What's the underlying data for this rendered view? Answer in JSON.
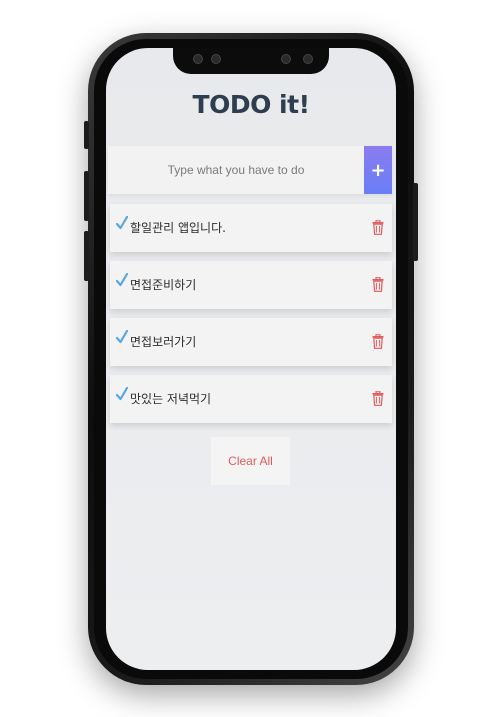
{
  "app": {
    "title": "TODO it!"
  },
  "input": {
    "placeholder": "Type what you have to do",
    "value": ""
  },
  "add_button": {
    "label": "+"
  },
  "todos": [
    {
      "text": "할일관리 앱입니다.",
      "completed": false
    },
    {
      "text": "면접준비하기",
      "completed": false
    },
    {
      "text": "면접보러가기",
      "completed": false
    },
    {
      "text": "맛있는 저녁먹기",
      "completed": false
    }
  ],
  "clear_button": {
    "label": "Clear All"
  },
  "colors": {
    "accent": "#7b7ef2",
    "title": "#2c3e50",
    "check": "#5aa6e0",
    "trash": "#e25a5a",
    "clear_text": "#e25a5a"
  },
  "icons": {
    "check": "check-icon",
    "trash": "trash-icon",
    "add": "plus-icon"
  }
}
